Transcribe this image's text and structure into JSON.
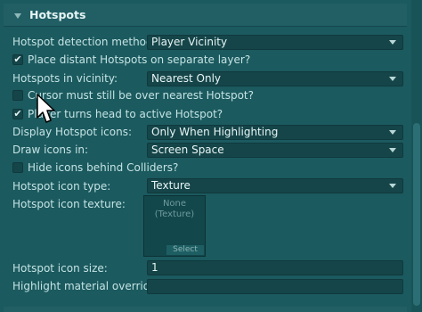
{
  "section": {
    "title": "Hotspots"
  },
  "rows": {
    "detection": {
      "label": "Hotspot detection method",
      "value": "Player Vicinity"
    },
    "distant_layer": {
      "label": "Place distant Hotspots on separate layer?",
      "checked": true
    },
    "in_vicinity": {
      "label": "Hotspots in vicinity:",
      "value": "Nearest Only"
    },
    "cursor_over": {
      "label": "Cursor must still be over nearest Hotspot?",
      "checked": false
    },
    "turns_head": {
      "label": "Player turns head to active Hotspot?",
      "checked": true
    },
    "display_icons": {
      "label": "Display Hotspot icons:",
      "value": "Only When Highlighting"
    },
    "draw_icons_in": {
      "label": "Draw icons in:",
      "value": "Screen Space"
    },
    "hide_behind": {
      "label": "Hide icons behind Colliders?",
      "checked": false
    },
    "icon_type": {
      "label": "Hotspot icon type:",
      "value": "Texture"
    },
    "icon_texture": {
      "label": "Hotspot icon texture:",
      "none_text_line1": "None",
      "none_text_line2": "(Texture)",
      "select_label": "Select"
    },
    "icon_size": {
      "label": "Hotspot icon size:",
      "value": "1"
    },
    "highlight_material": {
      "label": "Highlight material override",
      "value": ""
    }
  },
  "icons": {
    "checkmark": "✔"
  }
}
